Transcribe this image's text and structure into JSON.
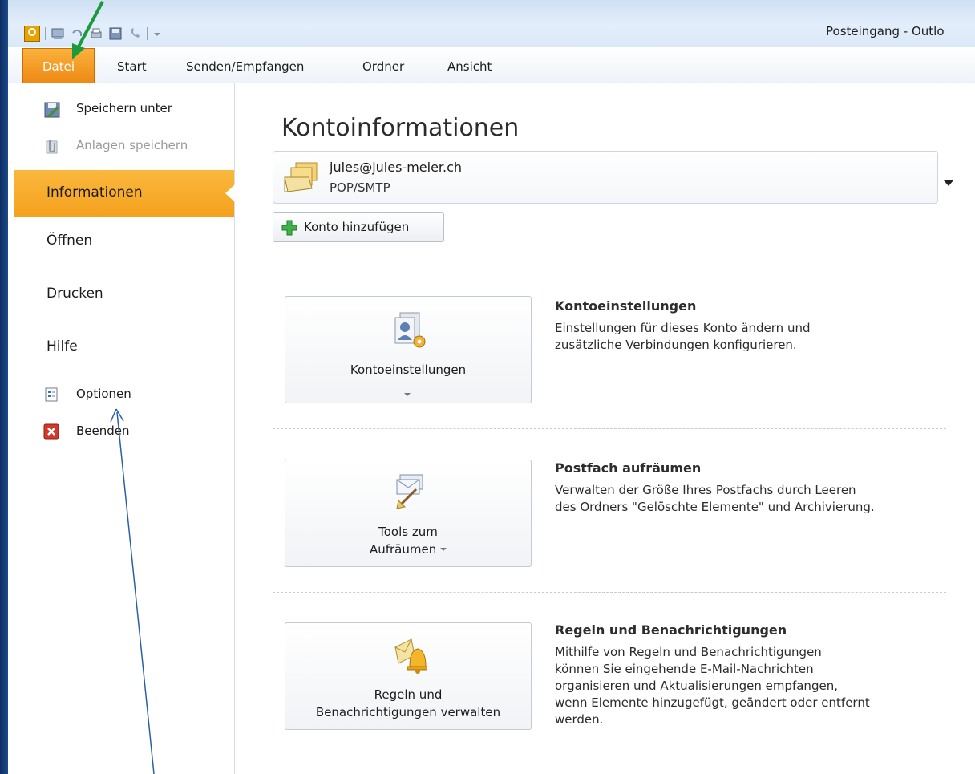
{
  "window": {
    "title": "Posteingang - Outlo"
  },
  "ribbon": {
    "file_tab": "Datei",
    "tabs": [
      "Start",
      "Senden/Empfangen",
      "Ordner",
      "Ansicht"
    ]
  },
  "sidebar": {
    "save_as": "Speichern unter",
    "save_attachments": "Anlagen speichern",
    "info": "Informationen",
    "open": "Öffnen",
    "print": "Drucken",
    "help": "Hilfe",
    "options": "Optionen",
    "exit": "Beenden"
  },
  "main": {
    "heading": "Kontoinformationen",
    "account": {
      "email": "jules@jules-meier.ch",
      "type": "POP/SMTP"
    },
    "add_account": "Konto hinzufügen",
    "sections": [
      {
        "button_line1": "Kontoeinstellungen",
        "button_line2": "",
        "title": "Kontoeinstellungen",
        "desc_line1": "Einstellungen für dieses Konto ändern und",
        "desc_line2": "zusätzliche Verbindungen konfigurieren."
      },
      {
        "button_line1": "Tools zum",
        "button_line2": "Aufräumen",
        "title": "Postfach aufräumen",
        "desc_line1": "Verwalten der Größe Ihres Postfachs durch Leeren",
        "desc_line2": "des Ordners \"Gelöschte Elemente\" und Archivierung."
      },
      {
        "button_line1": "Regeln und",
        "button_line2": "Benachrichtigungen verwalten",
        "title": "Regeln und Benachrichtigungen",
        "desc_line1": "Mithilfe von Regeln und Benachrichtigungen",
        "desc_line2": "können Sie eingehende E-Mail-Nachrichten",
        "desc_line3": "organisieren und Aktualisierungen empfangen,",
        "desc_line4": "wenn Elemente hinzugefügt, geändert oder entfernt",
        "desc_line5": "werden."
      }
    ]
  },
  "colors": {
    "accent_orange": "#f4a11d",
    "annotation_green": "#1a9a3a",
    "annotation_blue": "#2b5fa8"
  }
}
